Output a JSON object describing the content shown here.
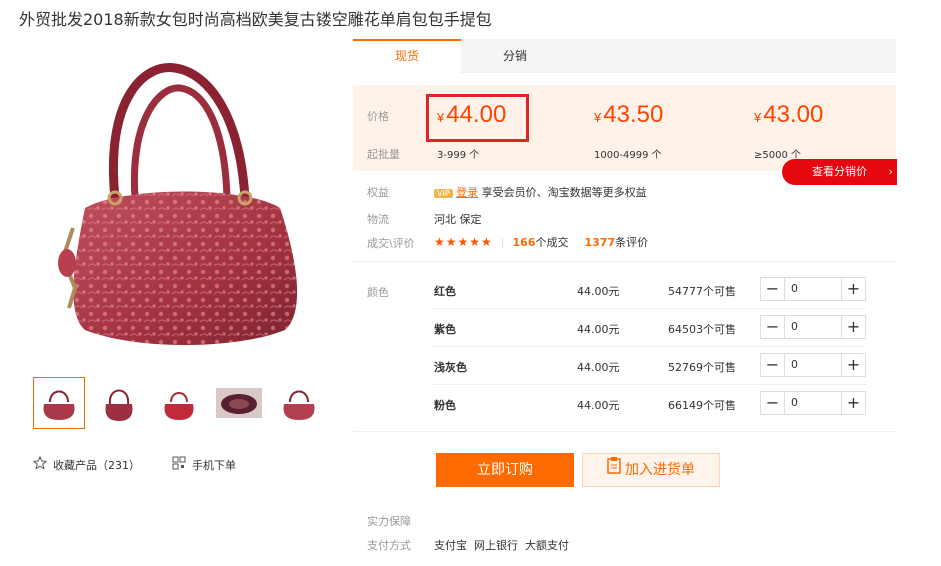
{
  "product": {
    "title": "外贸批发2018新款女包时尚高档欧美复古镂空雕花单肩包包手提包"
  },
  "gallery": {
    "favorite_label": "收藏产品（231）",
    "mobile_order_label": "手机下单"
  },
  "tabs": [
    {
      "label": "现货",
      "active": true
    },
    {
      "label": "分销",
      "active": false
    }
  ],
  "price_panel": {
    "price_label": "价格",
    "batch_label": "起批量",
    "currency": "¥",
    "tiers": [
      {
        "price": "44.00",
        "qty": "3-999 个"
      },
      {
        "price": "43.50",
        "qty": "1000-4999 个"
      },
      {
        "price": "43.00",
        "qty": "≥5000 个"
      }
    ],
    "dist_price_button": "查看分销价",
    "dist_arrow": "›"
  },
  "info": {
    "rights_label": "权益",
    "vip_badge": "VIP",
    "login_link": "登录",
    "rights_text": "享受会员价、淘宝数据等更多权益",
    "logistics_label": "物流",
    "logistics_value": "河北 保定",
    "deals_label": "成交\\评价",
    "stars": "★★★★★",
    "deals_count": "166",
    "deals_suffix": "个成交",
    "reviews_count": "1377",
    "reviews_suffix": "条评价"
  },
  "sku": {
    "color_label": "颜色",
    "rows": [
      {
        "name": "红色",
        "price": "44.00元",
        "stock": "54777个可售",
        "qty": "0"
      },
      {
        "name": "紫色",
        "price": "44.00元",
        "stock": "64503个可售",
        "qty": "0"
      },
      {
        "name": "浅灰色",
        "price": "44.00元",
        "stock": "52769个可售",
        "qty": "0"
      },
      {
        "name": "粉色",
        "price": "44.00元",
        "stock": "66149个可售",
        "qty": "0"
      }
    ]
  },
  "actions": {
    "order_button": "立即订购",
    "cart_button": "加入进货单"
  },
  "guarantee": {
    "guarantee_label": "实力保障",
    "payment_label": "支付方式",
    "payment_methods": "支付宝  网上银行  大额支付"
  },
  "colors": {
    "accent": "#ff6a00",
    "price_red": "#ff4400",
    "highlight_box": "#e0242b",
    "dist_button_bg": "#e5080f",
    "price_panel_bg": "#fff2e9"
  },
  "icons": {
    "star": "star-outline-icon",
    "mobile": "qr-grid-icon",
    "cart": "clipboard-icon"
  }
}
